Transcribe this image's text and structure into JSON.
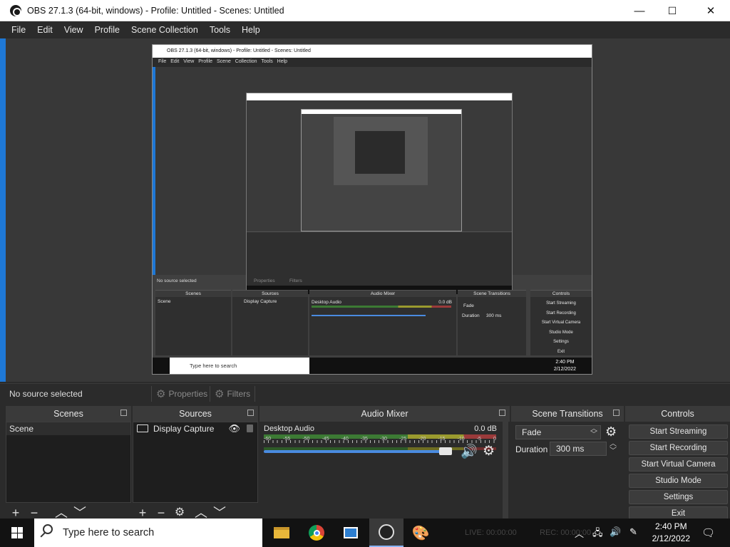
{
  "window": {
    "title": "OBS 27.1.3 (64-bit, windows) - Profile: Untitled - Scenes: Untitled",
    "minimize": "—",
    "maximize": "☐",
    "close": "✕"
  },
  "menu": [
    "File",
    "Edit",
    "View",
    "Profile",
    "Scene Collection",
    "Tools",
    "Help"
  ],
  "status": {
    "no_source": "No source selected",
    "properties": "Properties",
    "filters": "Filters"
  },
  "docks": {
    "scenes": {
      "title": "Scenes",
      "items": [
        "Scene"
      ]
    },
    "sources": {
      "title": "Sources",
      "items": [
        "Display Capture"
      ]
    },
    "mixer": {
      "title": "Audio Mixer",
      "channel": "Desktop Audio",
      "level": "0.0 dB",
      "ticks": [
        "-60",
        "-55",
        "-50",
        "-45",
        "-40",
        "-35",
        "-30",
        "-25",
        "-20",
        "-15",
        "-10",
        "-5",
        "0"
      ],
      "volume_fraction": 0.97
    },
    "transitions": {
      "title": "Scene Transitions",
      "transition": "Fade",
      "duration_label": "Duration",
      "duration_value": "300 ms"
    },
    "controls": {
      "title": "Controls",
      "buttons": [
        "Start Streaming",
        "Start Recording",
        "Start Virtual Camera",
        "Studio Mode",
        "Settings",
        "Exit"
      ]
    }
  },
  "inner_preview": {
    "title": "OBS 27.1.3 (64-bit, windows) - Profile: Untitled - Scenes: Untitled",
    "menu": "File Edit View Profile Scene Collection Tools Help",
    "no_source": "No source selected",
    "properties": "Properties",
    "filters": "Filters",
    "scenes": "Scenes",
    "sources": "Sources",
    "mixer": "Audio Mixer",
    "transitions": "Scene Transitions",
    "controls": "Controls",
    "scene_item": "Scene",
    "source_item": "Display Capture",
    "channel": "Desktop Audio",
    "level": "0.0 dB",
    "fade": "Fade",
    "duration": "Duration",
    "duration_value": "300 ms",
    "buttons": [
      "Start Streaming",
      "Start Recording",
      "Start Virtual Camera",
      "Studio Mode",
      "Settings",
      "Exit"
    ],
    "search": "Type here to search",
    "time": "2:40 PM",
    "date": "2/12/2022"
  },
  "taskbar": {
    "search_placeholder": "Type here to search",
    "live": "LIVE: 00:00:00",
    "rec": "REC: 00:00:00",
    "time": "2:40 PM",
    "date": "2/12/2022"
  }
}
